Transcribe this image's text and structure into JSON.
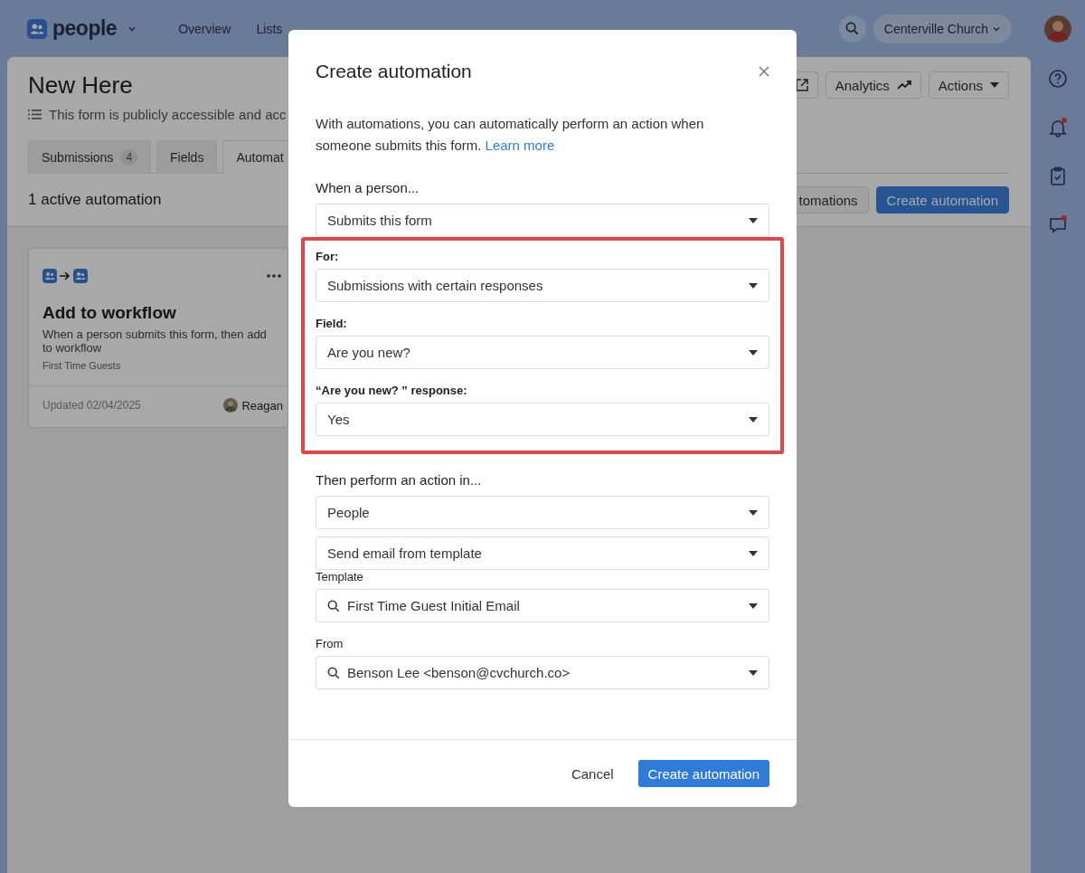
{
  "nav": {
    "app": "people",
    "items": [
      {
        "label": "Overview",
        "selected": false
      },
      {
        "label": "Lists",
        "selected": false
      }
    ],
    "org": "Centerville Church"
  },
  "rail": [
    {
      "kind": "help",
      "badge": false
    },
    {
      "kind": "bell",
      "badge": true
    },
    {
      "kind": "clipboard",
      "badge": false
    },
    {
      "kind": "chat",
      "badge": true
    }
  ],
  "page": {
    "title": "New Here",
    "subtitle": "This form is publicly accessible and acc",
    "header_buttons": [
      {
        "kind": "external"
      },
      {
        "kind": "analytics",
        "label": "Analytics"
      },
      {
        "kind": "actions",
        "label": "Actions"
      }
    ],
    "tabs": [
      {
        "label": "Submissions",
        "count": "4",
        "selected": false
      },
      {
        "label": "Fields",
        "selected": false
      },
      {
        "label": "Automat",
        "selected": true
      }
    ],
    "summary": "1 active automation",
    "actions": [
      {
        "label": "tomations",
        "kind": "secondary"
      },
      {
        "label": "Create automation",
        "kind": "primary"
      }
    ],
    "cards": [
      {
        "title": "Add to workflow",
        "description": "When a person submits this form, then add to workflow",
        "workflow": "First Time Guests",
        "updated": "Updated 02/04/2025",
        "owner": "Reagan"
      }
    ]
  },
  "modal": {
    "title": "Create automation",
    "intro": "With automations, you can automatically perform an action when someone submits this form.",
    "link": "Learn more",
    "groups": [
      {
        "highlighted": false,
        "fields": [
          {
            "kind": "heading",
            "label": "When a person...",
            "selects": [
              {
                "value": "Submits this form",
                "search": false
              }
            ]
          }
        ]
      },
      {
        "highlighted": true,
        "fields": [
          {
            "kind": "label",
            "label": "For:",
            "selects": [
              {
                "value": "Submissions with certain responses",
                "search": false
              }
            ]
          },
          {
            "kind": "label",
            "label": "Field:",
            "selects": [
              {
                "value": "Are you new?",
                "search": false
              }
            ]
          },
          {
            "kind": "label",
            "label": "“Are you new? ” response:",
            "selects": [
              {
                "value": "Yes",
                "search": false
              }
            ]
          }
        ]
      },
      {
        "highlighted": false,
        "fields": [
          {
            "kind": "heading",
            "label": "Then perform an action in...",
            "selects": [
              {
                "value": "People",
                "search": false
              },
              {
                "value": "Send email from template",
                "search": false
              }
            ]
          },
          {
            "kind": "plain",
            "label": "Template",
            "selects": [
              {
                "value": "First Time Guest Initial Email",
                "search": true
              }
            ]
          },
          {
            "kind": "plain",
            "label": "From",
            "selects": [
              {
                "value": "Benson Lee <benson@cvchurch.co>",
                "search": true
              }
            ]
          }
        ]
      }
    ],
    "buttons": [
      {
        "label": "Cancel",
        "kind": "secondary"
      },
      {
        "label": "Create automation",
        "kind": "primary"
      }
    ]
  }
}
